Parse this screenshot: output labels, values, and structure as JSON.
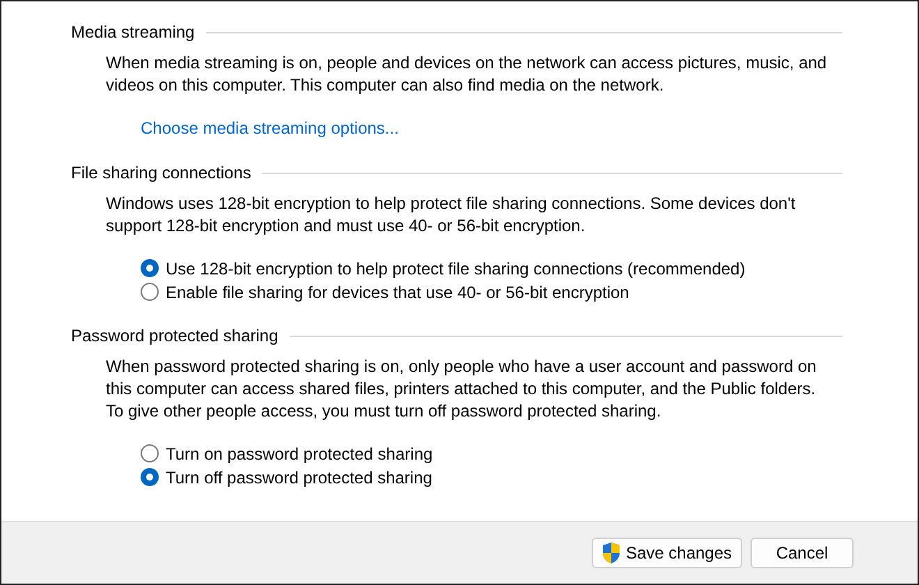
{
  "sections": [
    {
      "heading": "Media streaming",
      "description": "When media streaming is on, people and devices on the network can access pictures, music, and videos on this computer. This computer can also find media on the network.",
      "link": "Choose media streaming options..."
    },
    {
      "heading": "File sharing connections",
      "description": "Windows uses 128-bit encryption to help protect file sharing connections. Some devices don't support 128-bit encryption and must use 40- or 56-bit encryption.",
      "options": [
        {
          "label": "Use 128-bit encryption to help protect file sharing connections (recommended)",
          "selected": true
        },
        {
          "label": "Enable file sharing for devices that use 40- or 56-bit encryption",
          "selected": false
        }
      ]
    },
    {
      "heading": "Password protected sharing",
      "description": "When password protected sharing is on, only people who have a user account and password on this computer can access shared files, printers attached to this computer, and the Public folders. To give other people access, you must turn off password protected sharing.",
      "options": [
        {
          "label": "Turn on password protected sharing",
          "selected": false
        },
        {
          "label": "Turn off password protected sharing",
          "selected": true
        }
      ]
    }
  ],
  "buttons": [
    {
      "label": "Save changes",
      "kind": "shield"
    },
    {
      "label": "Cancel",
      "kind": "plain"
    }
  ]
}
